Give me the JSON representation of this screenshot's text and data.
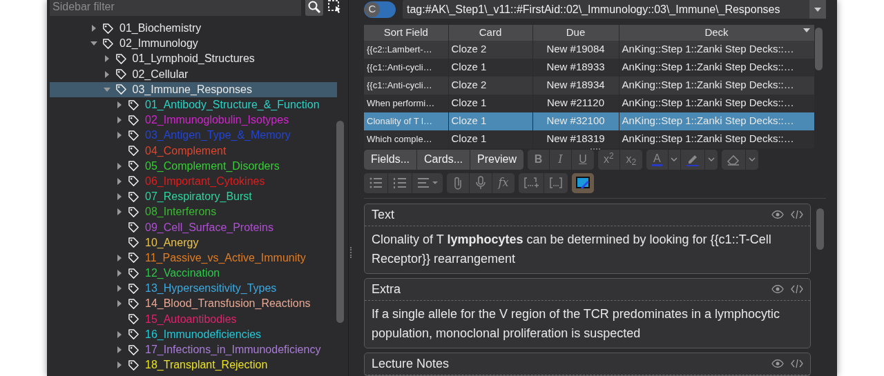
{
  "sidebar": {
    "filter": {
      "placeholder": "Sidebar filter"
    },
    "tree": [
      {
        "label": "01_Biochemistry",
        "expanded": false,
        "selected": false
      },
      {
        "label": "02_Immunology",
        "expanded": true,
        "selected": false,
        "children": [
          {
            "label": "01_Lymphoid_Structures",
            "expanded": false,
            "selected": false
          },
          {
            "label": "02_Cellular",
            "expanded": false,
            "selected": false
          },
          {
            "label": "03_Immune_Responses",
            "expanded": true,
            "selected": true,
            "children": [
              {
                "label": "01_Antibody_Structure_&_Function",
                "expanded": false,
                "selected": false,
                "color": "#2bd2c6"
              },
              {
                "label": "02_Immunoglobulin_Isotypes",
                "expanded": false,
                "selected": false,
                "color": "#d424d0"
              },
              {
                "label": "03_Antigen_Type_&_Memory",
                "expanded": false,
                "selected": false,
                "color": "#2244d8"
              },
              {
                "label": "04_Complement",
                "selected": false,
                "color": "#e2442c"
              },
              {
                "label": "05_Complement_Disorders",
                "expanded": false,
                "selected": false,
                "color": "#33d033"
              },
              {
                "label": "06_Important_Cytokines",
                "expanded": false,
                "selected": false,
                "color": "#e21c1c"
              },
              {
                "label": "07_Respiratory_Burst",
                "expanded": false,
                "selected": false,
                "color": "#2ad89c"
              },
              {
                "label": "08_Interferons",
                "expanded": false,
                "selected": false,
                "color": "#38bb30"
              },
              {
                "label": "09_Cell_Surface_Proteins",
                "selected": false,
                "color": "#b24ed8"
              },
              {
                "label": "10_Anergy",
                "selected": false,
                "color": "#eac44c"
              },
              {
                "label": "11_Passive_vs_Active_Immunity",
                "expanded": false,
                "selected": false,
                "color": "#e27c22"
              },
              {
                "label": "12_Vaccination",
                "expanded": false,
                "selected": false,
                "color": "#2ec84c"
              },
              {
                "label": "13_Hypersensitivity_Types",
                "expanded": false,
                "selected": false,
                "color": "#3caae2"
              },
              {
                "label": "14_Blood_Transfusion_Reactions",
                "expanded": false,
                "selected": false,
                "color": "#eaa892"
              },
              {
                "label": "15_Autoantibodies",
                "selected": false,
                "color": "#e2226c"
              },
              {
                "label": "16_Immunodeficiencies",
                "expanded": false,
                "selected": false,
                "color": "#22cad8"
              },
              {
                "label": "17_Infections_in_Immunodeficiency",
                "expanded": false,
                "selected": false,
                "color": "#aa7cda"
              },
              {
                "label": "18_Transplant_Rejection",
                "expanded": false,
                "selected": false,
                "color": "#eae222"
              }
            ]
          }
        ]
      }
    ]
  },
  "search": {
    "toggle": {
      "label": "C",
      "on": false
    },
    "query": "tag:#AK\\_Step1\\_v11::#FirstAid::02\\_Immunology::03\\_Immune\\_Responses"
  },
  "table": {
    "columns": [
      {
        "label": "Sort Field",
        "sorted": false
      },
      {
        "label": "Card",
        "sorted": false
      },
      {
        "label": "Due",
        "sorted": false
      },
      {
        "label": "Deck",
        "sorted": true
      }
    ],
    "rows": [
      {
        "cells": [
          "{{c2::Lambert-…",
          "Cloze 2",
          "New #19084",
          "AnKing::Step 1::Zanki Step Decks::…"
        ],
        "selected": false
      },
      {
        "cells": [
          "{{c1::Anti-cycli…",
          "Cloze 1",
          "New #18933",
          "AnKing::Step 1::Zanki Step Decks::…"
        ],
        "selected": false
      },
      {
        "cells": [
          "{{c1::Anti-cycli…",
          "Cloze 2",
          "New #18934",
          "AnKing::Step 1::Zanki Step Decks::…"
        ],
        "selected": false
      },
      {
        "cells": [
          "When performi…",
          "Cloze 1",
          "New #21120",
          "AnKing::Step 1::Zanki Step Decks::…"
        ],
        "selected": false
      },
      {
        "cells": [
          "Clonality of T l…",
          "Cloze 1",
          "New #32100",
          "AnKing::Step 1::Zanki Step Decks::…"
        ],
        "selected": true
      },
      {
        "cells": [
          "Which comple…",
          "Cloze 1",
          "New #18319",
          "AnKing::Step 1::Zanki Step Decks::…"
        ],
        "selected": false
      }
    ]
  },
  "toolbar": {
    "row_1": [
      [
        {
          "kind": "text",
          "label": "Fields...",
          "disabled": false
        },
        {
          "kind": "text",
          "label": "Cards...",
          "disabled": false
        },
        {
          "kind": "text",
          "label": "Preview",
          "disabled": false
        }
      ],
      [
        {
          "kind": "bold",
          "label": "B",
          "disabled": true
        },
        {
          "kind": "italic",
          "label": "I",
          "disabled": true
        },
        {
          "kind": "underline",
          "label": "U",
          "disabled": true
        }
      ],
      [
        {
          "kind": "text",
          "label": "x$^{2}$",
          "disabled": true
        },
        {
          "kind": "text",
          "label": "x$_{2}$",
          "disabled": true
        }
      ],
      [
        {
          "kind": "color",
          "label": "A",
          "disabled": true
        },
        {
          "kind": "caret",
          "disabled": true
        },
        {
          "kind": "highlight",
          "disabled": true
        },
        {
          "kind": "caret",
          "disabled": true
        }
      ],
      [
        {
          "kind": "eraser",
          "disabled": true
        },
        {
          "kind": "caret",
          "disabled": true
        }
      ]
    ],
    "row_2": [
      [
        {
          "kind": "bullets",
          "disabled": true
        },
        {
          "kind": "numbers",
          "disabled": true
        },
        {
          "kind": "align",
          "disabled": true
        }
      ],
      [
        {
          "kind": "clip",
          "disabled": true
        },
        {
          "kind": "mic",
          "disabled": true
        },
        {
          "kind": "formula",
          "label": "fx",
          "disabled": true
        }
      ],
      [
        {
          "kind": "clozeplus",
          "disabled": true
        },
        {
          "kind": "cloze",
          "disabled": true
        }
      ],
      [
        {
          "kind": "occlusion"
        }
      ]
    ]
  },
  "fields": [
    {
      "name": "Text",
      "body": "Clonality of T **lymphocytes** can be determined by looking for {{c1::T-Cell Receptor}} rearrangement"
    },
    {
      "name": "Extra",
      "body": "If a single allele for the V region of the TCR predominates in a lymphocytic population, monoclonal proliferation is suspected"
    },
    {
      "name": "Lecture Notes"
    }
  ]
}
